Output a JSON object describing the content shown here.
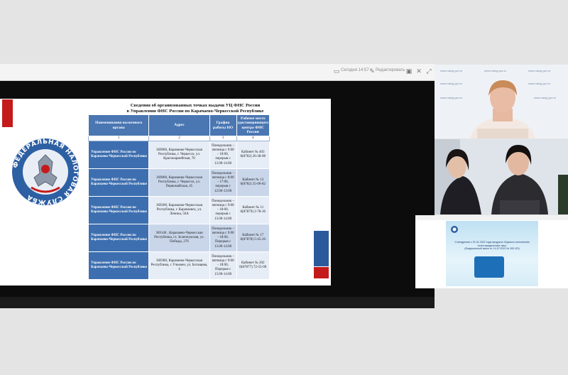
{
  "toolbar": {
    "today_label": "Сегодня 14:57",
    "edit_label": "Редактировать"
  },
  "slide": {
    "title_line1": "Сведения об организованных точках выдачи УЦ ФНС России",
    "title_line2": "в Управлении ФНС России по Карачаево-Черкесской Республике",
    "emblem_text": "ФЕДЕРАЛЬНАЯ НАЛОГОВАЯ СЛУЖБА",
    "table": {
      "headers": [
        "Наименования налогового органа",
        "Адрес",
        "График работы НО",
        "Рабочее место удостоверяющего центра ФНС России"
      ],
      "numbers": [
        "1",
        "2",
        "3",
        "4"
      ],
      "rows": [
        {
          "org": "Управление ФНС России по Карачаево-Черкесской Республике",
          "address": "369000, Карачаево-Черкесская Республика, г. Черкесск, ул. Красноармейская, 70",
          "schedule": "Понедельник – пятница с 9:00 - 18:00, перерыв с 13.00-14.00",
          "workplace": "Кабинет № 403 8(8782) 26-38-08"
        },
        {
          "org": "Управление ФНС России по Карачаево-Черкесской Республике",
          "address": "369000, Карачаево-Черкесская Республика, г. Черкесск, ул. Первомайская, 45",
          "schedule": "Понедельник – пятница с 8:00 - 17:00, перерыв с 12:00-13:00",
          "workplace": "Кабинет № 13 8(8782) 25-00-82"
        },
        {
          "org": "Управление ФНС России по Карачаево-Черкесской Республике",
          "address": "369200, Карачаево-Черкесская Республика, г. Карачаевск, ул. Ленина, 56А",
          "schedule": "Понедельник – пятница с 9:00 - 18:00, перерыв с 13.00-14.00",
          "workplace": "Кабинет № 11 8(87879) 2-78-36"
        },
        {
          "org": "Управление ФНС России по Карачаево-Черкесской Республике",
          "address": "369140 , Карачаево-Черкесская Республика, ст. Зеленчукская, ул. Победы, 276",
          "schedule": "Понедельник – пятница с 9:00 - 18:00, Перерыв с 13.00-14.00",
          "workplace": "Кабинет № 17 8(87878) 5-45-26"
        },
        {
          "org": "Управление ФНС России по Карачаево-Черкесской Республике",
          "address": "369380, Карачаево-Черкесская Республика, с Учкекен, ул. Ботащева, 4",
          "schedule": "Понедельник – пятница с 9:00 - 18:00, Перерыв с 13.00-14.00",
          "workplace": "Кабинет № 202 8(87877) 72-55-00"
        }
      ]
    }
  },
  "video": {
    "wall_text": "www.nalog.gov.ru"
  },
  "shared": {
    "line1": "О внедрении с 01.01.2022 года продукта «Единого исполнения",
    "line2": "точек юридических лиц»",
    "line3": "(Федеральный закон от 14.07.2021 № 262-ФЗ)"
  },
  "colors": {
    "table_header": "#4a76b2",
    "accent_red": "#c41a1a",
    "accent_blue": "#2a5a9c"
  }
}
